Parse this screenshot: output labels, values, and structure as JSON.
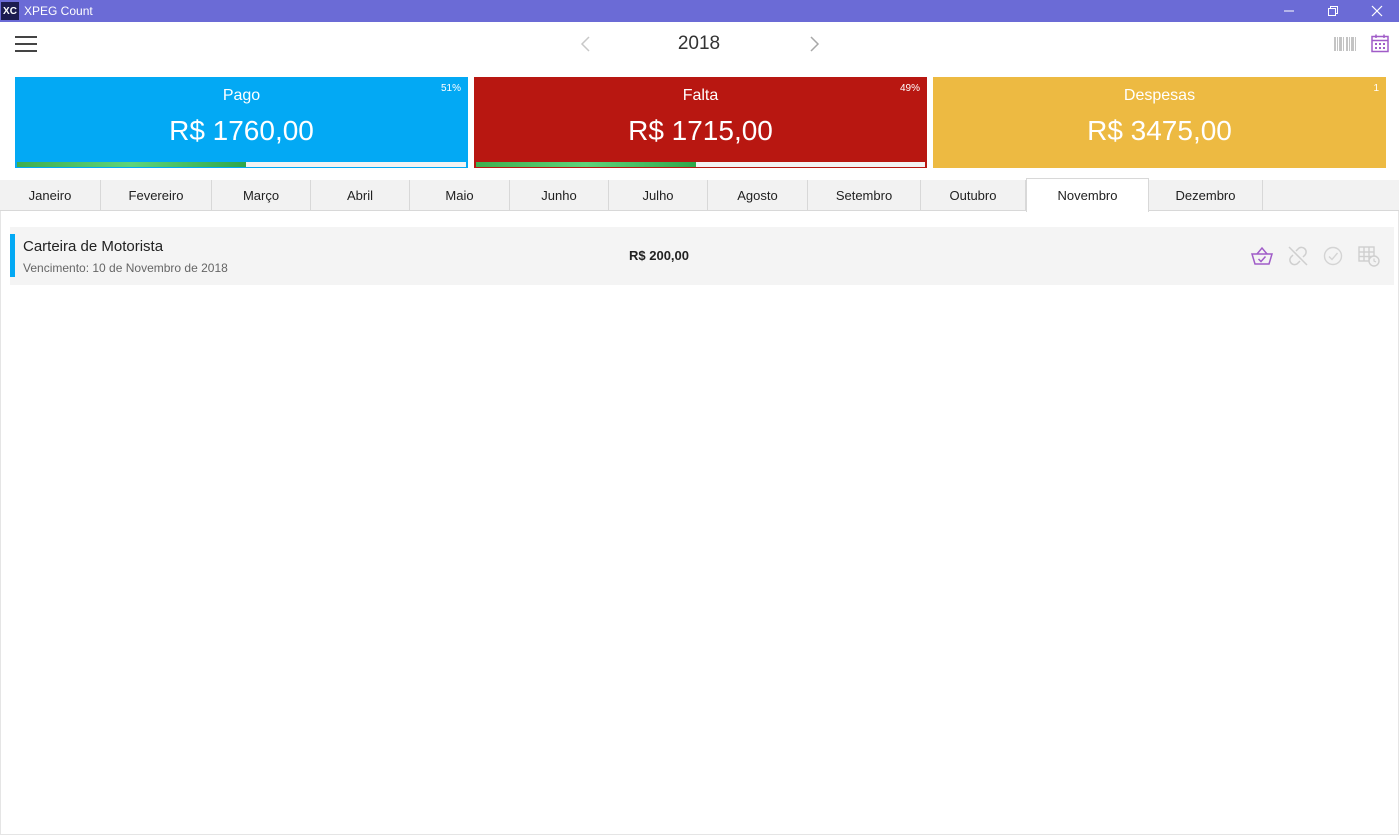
{
  "window": {
    "logo_text": "XC",
    "title": "XPEG Count",
    "controls": [
      "minimize-icon",
      "restore-icon",
      "close-icon"
    ]
  },
  "header": {
    "menu_icon": "hamburger-icon",
    "year": "2018",
    "prev_icon": "chevron-left-icon",
    "next_icon": "chevron-right-icon",
    "right_icons": [
      "barcode-layout-icon",
      "calendar-icon"
    ]
  },
  "summary": {
    "pago": {
      "title": "Pago",
      "value": "R$ 1760,00",
      "badge": "51%",
      "progress": 0.51,
      "color": "#03a9f4"
    },
    "falta": {
      "title": "Falta",
      "value": "R$ 1715,00",
      "badge": "49%",
      "progress": 0.49,
      "color": "#b81711"
    },
    "despesas": {
      "title": "Despesas",
      "value": "R$ 3475,00",
      "badge": "1",
      "color": "#edba42"
    }
  },
  "months": [
    "Janeiro",
    "Fevereiro",
    "Março",
    "Abril",
    "Maio",
    "Junho",
    "Julho",
    "Agosto",
    "Setembro",
    "Outubro",
    "Novembro",
    "Dezembro"
  ],
  "active_month": "Novembro",
  "bills": [
    {
      "name": "Carteira de Motorista",
      "due": "Vencimento: 10 de Novembro de 2018",
      "amount": "R$ 200,00",
      "accent": "#03a9f4",
      "actions": [
        "basket-icon",
        "unlink-icon",
        "check-circle-icon",
        "table-clock-icon"
      ]
    }
  ],
  "colors": {
    "titlebar": "#6b6bd6",
    "accent_purple": "#a05cc8"
  }
}
